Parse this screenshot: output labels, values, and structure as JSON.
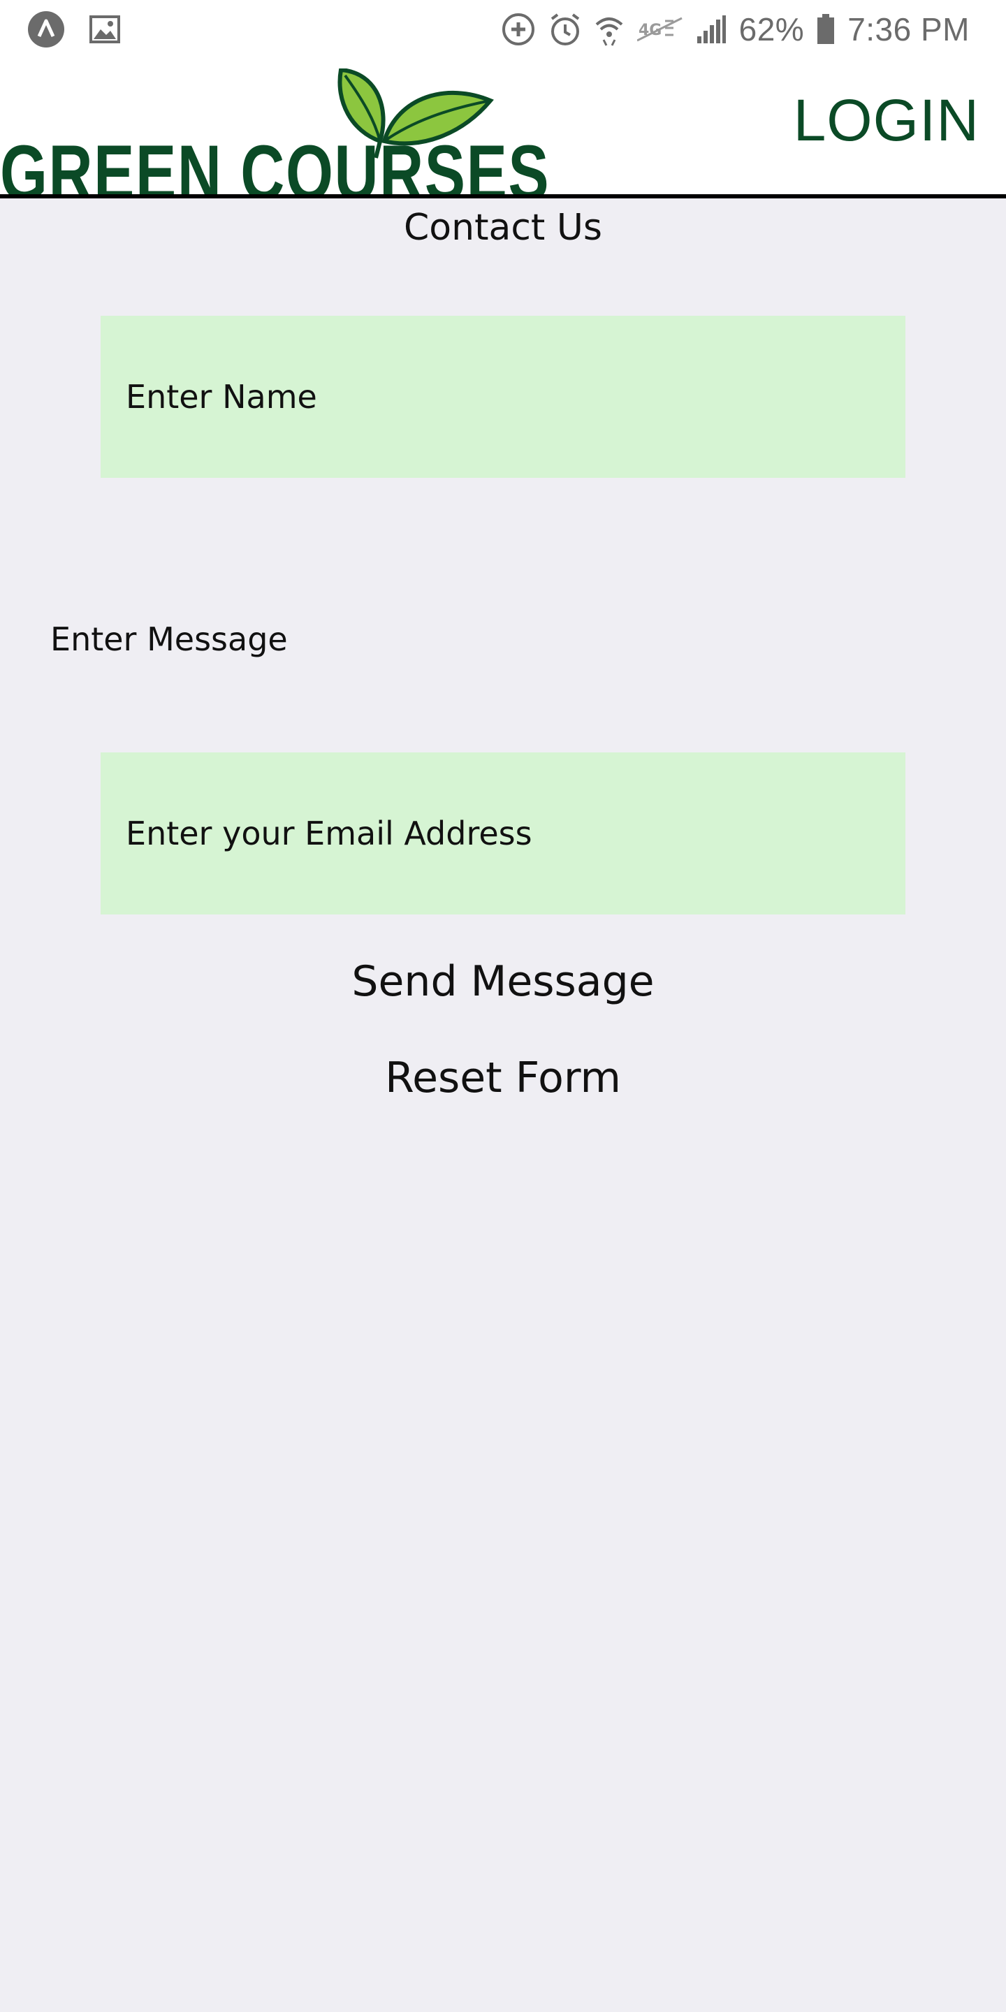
{
  "status_bar": {
    "battery_percent": "62%",
    "time": "7:36 PM",
    "icons": [
      "app-icon",
      "image-icon",
      "sync-icon",
      "alarm-icon",
      "wifi-icon",
      "lte-icon",
      "signal-icon",
      "battery-icon"
    ]
  },
  "header": {
    "brand": "GREEN COURSES",
    "login_label": "LOGIN",
    "brand_color": "#0b4a26"
  },
  "form": {
    "title": "Contact Us",
    "name_placeholder": "Enter Name",
    "message_label": "Enter Message",
    "email_placeholder": "Enter your Email Address",
    "send_label": "Send Message",
    "reset_label": "Reset Form",
    "field_bg": "#d6f4d3"
  }
}
